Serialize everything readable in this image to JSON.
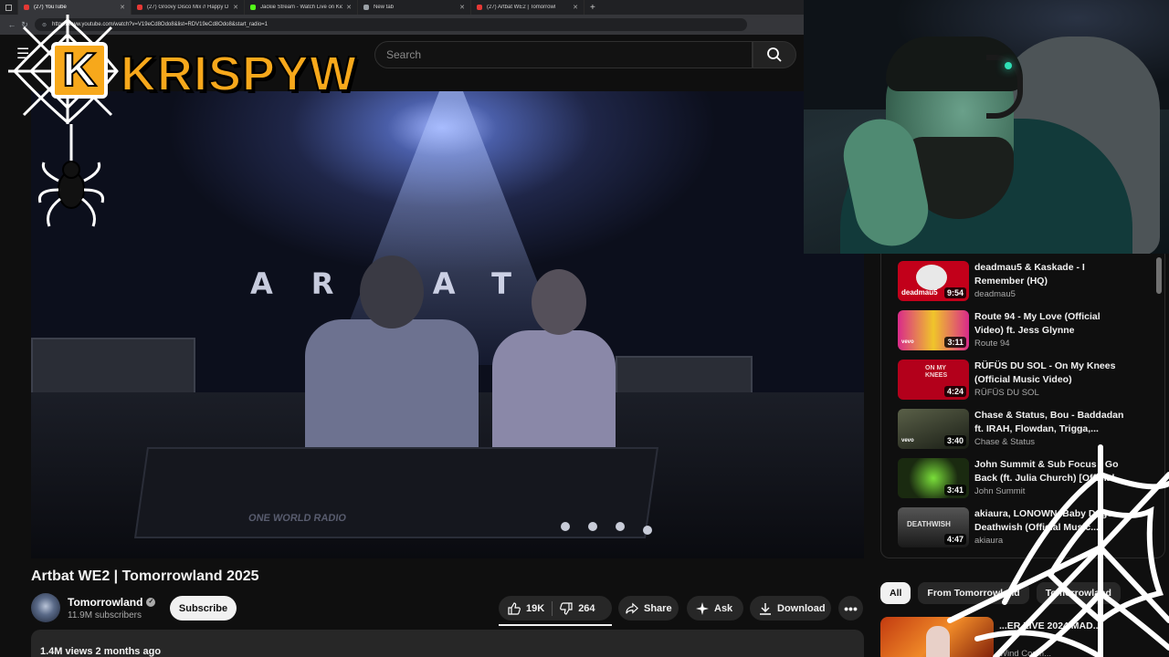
{
  "browser": {
    "tabs": [
      {
        "title": "(27) YouTube",
        "fav": "#e53935"
      },
      {
        "title": "(27) Groovy Disco Mix // Happy D",
        "fav": "#e53935"
      },
      {
        "title": "Jackie Stream - Watch Live on Kic",
        "fav": "#53fc18"
      },
      {
        "title": "New tab",
        "fav": "#9aa0a6"
      },
      {
        "title": "(27) Artbat WE2 | Tomorrowl",
        "fav": "#e53935"
      }
    ],
    "url": "https://www.youtube.com/watch?v=V19eCd8Odo8&list=RDV19eCd8Odo8&start_radio=1"
  },
  "header": {
    "search_placeholder": "Search"
  },
  "video": {
    "backdrop_text": "ARBAT",
    "stage_text": "ONE WORLD RADIO",
    "title": "Artbat WE2 | Tomorrowland 2025",
    "channel": "Tomorrowland",
    "subscribers": "11.9M subscribers",
    "subscribe_label": "Subscribe",
    "likes": "19K",
    "dislikes": "264",
    "share_label": "Share",
    "ask_label": "Ask",
    "download_label": "Download",
    "description_meta": "1.4M views  2 months ago"
  },
  "overlay": {
    "logo_text": "KRISPYW",
    "logo_letter": "K"
  },
  "recommendations": [
    {
      "title": "deadmau5 & Kaskade - I Remember (HQ)",
      "channel": "deadmau5",
      "duration": "9:54",
      "thumb_color": "#c2001a",
      "thumb_label": "deadmau5"
    },
    {
      "title": "Route 94 - My Love (Official Video) ft. Jess Glynne",
      "channel": "Route 94",
      "duration": "3:11",
      "thumb_color": "#d92a8a",
      "thumb_label": "vevo"
    },
    {
      "title": "RÜFÜS DU SOL - On My Knees (Official Music Video)",
      "channel": "RÜFÜS DU SOL",
      "duration": "4:24",
      "thumb_color": "#b3001b",
      "thumb_label": "ON MY KNEES"
    },
    {
      "title": "Chase & Status, Bou - Baddadan ft. IRAH, Flowdan, Trigga,...",
      "channel": "Chase & Status",
      "duration": "3:40",
      "thumb_color": "#3a4030",
      "thumb_label": "vevo"
    },
    {
      "title": "John Summit & Sub Focus - Go Back (ft. Julia Church) [Official",
      "channel": "John Summit",
      "duration": "3:41",
      "thumb_color": "#1a2a10",
      "thumb_label": ""
    },
    {
      "title": "akiaura, LONOWN, Baby Doge - Deathwish (Official Music...",
      "channel": "akiaura",
      "duration": "4:47",
      "thumb_color": "#3a3a3a",
      "thumb_label": "DEATHWISH"
    }
  ],
  "chips": [
    "All",
    "From Tomorrowland",
    "Tomorrowland"
  ],
  "bottom_rec": {
    "title": "...ER LIVE 2024 MAD...",
    "channel": "Wind Cosm..."
  }
}
